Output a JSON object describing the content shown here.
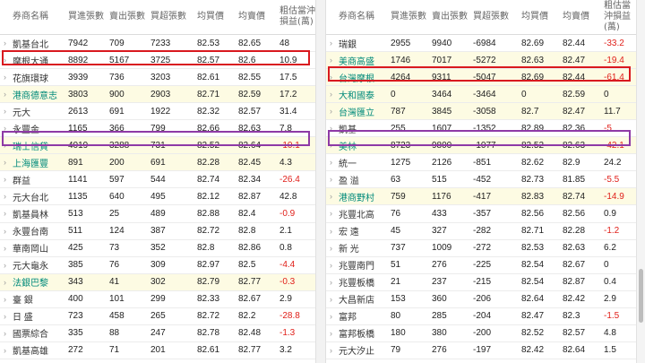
{
  "headers": [
    "券商名稱",
    "買進張數",
    "賣出張數",
    "買超張數",
    "均買價",
    "均賣價",
    "粗估當沖損益(萬)"
  ],
  "left_rows": [
    {
      "name": "凱基台北",
      "buy": "7942",
      "sell": "709",
      "net": "7233",
      "avg_buy": "82.53",
      "avg_sell": "82.65",
      "pnl": "48",
      "hl": false
    },
    {
      "name": "摩根大通",
      "buy": "8892",
      "sell": "5167",
      "net": "3725",
      "avg_buy": "82.57",
      "avg_sell": "82.6",
      "pnl": "10.9",
      "hl": false
    },
    {
      "name": "花旗環球",
      "buy": "3939",
      "sell": "736",
      "net": "3203",
      "avg_buy": "82.61",
      "avg_sell": "82.55",
      "pnl": "17.5",
      "hl": false
    },
    {
      "name": "港商德意志",
      "buy": "3803",
      "sell": "900",
      "net": "2903",
      "avg_buy": "82.71",
      "avg_sell": "82.59",
      "pnl": "17.2",
      "hl": true
    },
    {
      "name": "元大",
      "buy": "2613",
      "sell": "691",
      "net": "1922",
      "avg_buy": "82.32",
      "avg_sell": "82.57",
      "pnl": "31.4",
      "hl": false
    },
    {
      "name": "永豐金",
      "buy": "1165",
      "sell": "366",
      "net": "799",
      "avg_buy": "82.66",
      "avg_sell": "82.63",
      "pnl": "7.8",
      "hl": false
    },
    {
      "name": "瑞士信貸",
      "buy": "4019",
      "sell": "3288",
      "net": "731",
      "avg_buy": "82.52",
      "avg_sell": "82.64",
      "pnl": "-10.1",
      "hl": true
    },
    {
      "name": "上海匯豐",
      "buy": "891",
      "sell": "200",
      "net": "691",
      "avg_buy": "82.28",
      "avg_sell": "82.45",
      "pnl": "4.3",
      "hl": true
    },
    {
      "name": "群益",
      "buy": "1141",
      "sell": "597",
      "net": "544",
      "avg_buy": "82.74",
      "avg_sell": "82.34",
      "pnl": "-26.4",
      "hl": false
    },
    {
      "name": "元大台北",
      "buy": "1135",
      "sell": "640",
      "net": "495",
      "avg_buy": "82.12",
      "avg_sell": "82.87",
      "pnl": "42.8",
      "hl": false
    },
    {
      "name": "凱基員林",
      "buy": "513",
      "sell": "25",
      "net": "489",
      "avg_buy": "82.88",
      "avg_sell": "82.4",
      "pnl": "-0.9",
      "hl": false
    },
    {
      "name": "永豐台南",
      "buy": "511",
      "sell": "124",
      "net": "387",
      "avg_buy": "82.72",
      "avg_sell": "82.8",
      "pnl": "2.1",
      "hl": false
    },
    {
      "name": "華南岡山",
      "buy": "425",
      "sell": "73",
      "net": "352",
      "avg_buy": "82.8",
      "avg_sell": "82.86",
      "pnl": "0.8",
      "hl": false
    },
    {
      "name": "元大龜永",
      "buy": "385",
      "sell": "76",
      "net": "309",
      "avg_buy": "82.97",
      "avg_sell": "82.5",
      "pnl": "-4.4",
      "hl": false
    },
    {
      "name": "法銀巴黎",
      "buy": "343",
      "sell": "41",
      "net": "302",
      "avg_buy": "82.79",
      "avg_sell": "82.77",
      "pnl": "-0.3",
      "hl": true
    },
    {
      "name": "臺 銀",
      "buy": "400",
      "sell": "101",
      "net": "299",
      "avg_buy": "82.33",
      "avg_sell": "82.67",
      "pnl": "2.9",
      "hl": false
    },
    {
      "name": "日 盛",
      "buy": "723",
      "sell": "458",
      "net": "265",
      "avg_buy": "82.72",
      "avg_sell": "82.2",
      "pnl": "-28.8",
      "hl": false
    },
    {
      "name": "國票綜合",
      "buy": "335",
      "sell": "88",
      "net": "247",
      "avg_buy": "82.78",
      "avg_sell": "82.48",
      "pnl": "-1.3",
      "hl": false
    },
    {
      "name": "凱基高雄",
      "buy": "272",
      "sell": "71",
      "net": "201",
      "avg_buy": "82.61",
      "avg_sell": "82.77",
      "pnl": "3.2",
      "hl": false
    },
    {
      "name": "日盛台南",
      "buy": "209",
      "sell": "13",
      "net": "196",
      "avg_buy": "82.81",
      "avg_sell": "82.65",
      "pnl": "0.1",
      "hl": false
    }
  ],
  "right_rows": [
    {
      "name": "瑞銀",
      "buy": "2955",
      "sell": "9940",
      "net": "-6984",
      "avg_buy": "82.69",
      "avg_sell": "82.44",
      "pnl": "-33.2",
      "hl": false
    },
    {
      "name": "美商高盛",
      "buy": "1746",
      "sell": "7017",
      "net": "-5272",
      "avg_buy": "82.63",
      "avg_sell": "82.47",
      "pnl": "-19.4",
      "hl": true
    },
    {
      "name": "台灣摩根",
      "buy": "4264",
      "sell": "9311",
      "net": "-5047",
      "avg_buy": "82.69",
      "avg_sell": "82.44",
      "pnl": "-61.4",
      "hl": true
    },
    {
      "name": "大和國泰",
      "buy": "0",
      "sell": "3464",
      "net": "-3464",
      "avg_buy": "0",
      "avg_sell": "82.59",
      "pnl": "0",
      "hl": true
    },
    {
      "name": "台灣匯立",
      "buy": "787",
      "sell": "3845",
      "net": "-3058",
      "avg_buy": "82.7",
      "avg_sell": "82.47",
      "pnl": "11.7",
      "hl": true
    },
    {
      "name": "凱基",
      "buy": "255",
      "sell": "1607",
      "net": "-1352",
      "avg_buy": "82.89",
      "avg_sell": "82.36",
      "pnl": "-5",
      "hl": false
    },
    {
      "name": "美林",
      "buy": "8723",
      "sell": "9800",
      "net": "-1077",
      "avg_buy": "82.52",
      "avg_sell": "82.63",
      "pnl": "-42.1",
      "hl": true
    },
    {
      "name": "統一",
      "buy": "1275",
      "sell": "2126",
      "net": "-851",
      "avg_buy": "82.62",
      "avg_sell": "82.9",
      "pnl": "24.2",
      "hl": false
    },
    {
      "name": "盈 溢",
      "buy": "63",
      "sell": "515",
      "net": "-452",
      "avg_buy": "82.73",
      "avg_sell": "81.85",
      "pnl": "-5.5",
      "hl": false
    },
    {
      "name": "港商野村",
      "buy": "759",
      "sell": "1176",
      "net": "-417",
      "avg_buy": "82.83",
      "avg_sell": "82.74",
      "pnl": "-14.9",
      "hl": true
    },
    {
      "name": "兆豐北高",
      "buy": "76",
      "sell": "433",
      "net": "-357",
      "avg_buy": "82.56",
      "avg_sell": "82.56",
      "pnl": "0.9",
      "hl": false
    },
    {
      "name": "宏 遠",
      "buy": "45",
      "sell": "327",
      "net": "-282",
      "avg_buy": "82.71",
      "avg_sell": "82.28",
      "pnl": "-1.2",
      "hl": false
    },
    {
      "name": "新 光",
      "buy": "737",
      "sell": "1009",
      "net": "-272",
      "avg_buy": "82.53",
      "avg_sell": "82.63",
      "pnl": "6.2",
      "hl": false
    },
    {
      "name": "兆豐南門",
      "buy": "51",
      "sell": "276",
      "net": "-225",
      "avg_buy": "82.54",
      "avg_sell": "82.67",
      "pnl": "0",
      "hl": false
    },
    {
      "name": "兆豐板橋",
      "buy": "21",
      "sell": "237",
      "net": "-215",
      "avg_buy": "82.54",
      "avg_sell": "82.87",
      "pnl": "0.4",
      "hl": false
    },
    {
      "name": "大昌新店",
      "buy": "153",
      "sell": "360",
      "net": "-206",
      "avg_buy": "82.64",
      "avg_sell": "82.42",
      "pnl": "2.9",
      "hl": false
    },
    {
      "name": "富邦",
      "buy": "80",
      "sell": "285",
      "net": "-204",
      "avg_buy": "82.47",
      "avg_sell": "82.3",
      "pnl": "-1.5",
      "hl": false
    },
    {
      "name": "富邦板橋",
      "buy": "180",
      "sell": "380",
      "net": "-200",
      "avg_buy": "82.52",
      "avg_sell": "82.57",
      "pnl": "4.8",
      "hl": false
    },
    {
      "name": "元大汐止",
      "buy": "79",
      "sell": "276",
      "net": "-197",
      "avg_buy": "82.42",
      "avg_sell": "82.64",
      "pnl": "1.5",
      "hl": false
    },
    {
      "name": "福 邦",
      "buy": "25",
      "sell": "210",
      "net": "-185",
      "avg_buy": "82.61",
      "avg_sell": "82.16",
      "pnl": "-0.6",
      "hl": false
    }
  ]
}
